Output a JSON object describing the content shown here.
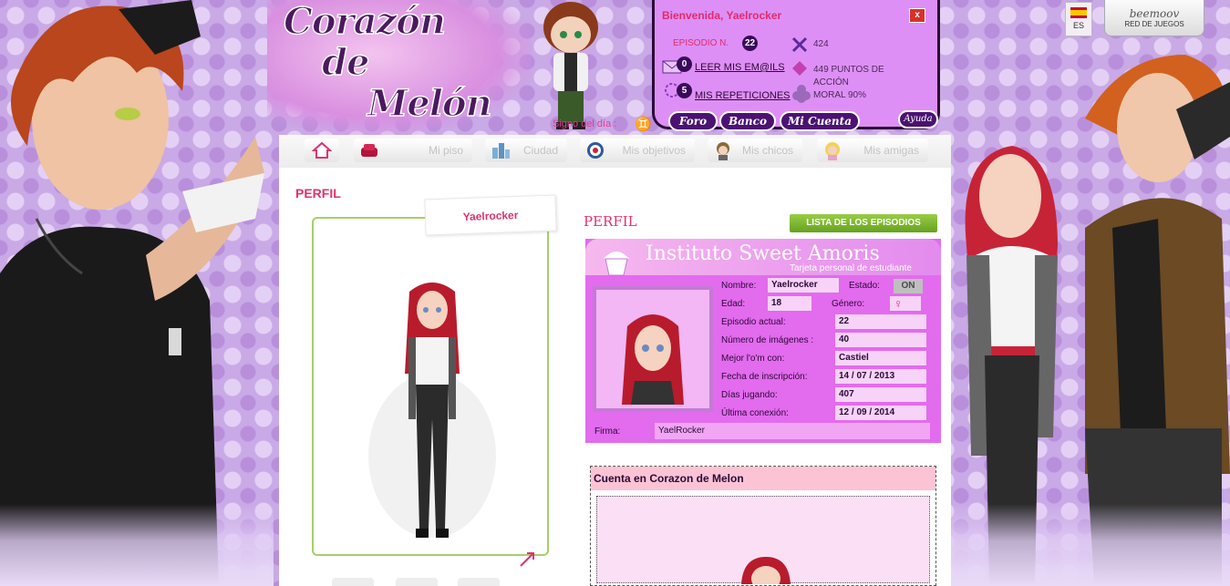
{
  "header": {
    "logo_line_1": "Corazón",
    "logo_line_2": "de",
    "logo_line_3": "Melón",
    "sign_label": "Signo del día :",
    "sign_icon": "gemini-icon"
  },
  "user_panel": {
    "welcome": "Bienvenida, Yaelrocker",
    "close_label": "x",
    "episode_label": "EPISODIO N.",
    "episode_number": "22",
    "stat_value": "424",
    "emails_count": "0",
    "emails_link": "LEER MIS EM@ILS",
    "action_points": "449 PUNTOS DE ACCIÓN",
    "reps_count": "5",
    "reps_link": "MIS REPETICIONES",
    "moral": "MORAL 90%",
    "buttons": [
      "Foro",
      "Banco",
      "Mi Cuenta"
    ],
    "help": "Ayuda"
  },
  "lang": {
    "label": "ES"
  },
  "beemoov": {
    "logo": "beemoov",
    "sub": "RED DE JUEGOS"
  },
  "nav": {
    "items": [
      {
        "label": "",
        "icon": "home-icon"
      },
      {
        "label": "Mi piso",
        "icon": "sofa-icon"
      },
      {
        "label": "Ciudad",
        "icon": "city-icon"
      },
      {
        "label": "Mis objetivos",
        "icon": "target-icon"
      },
      {
        "label": "Mis chicos",
        "icon": "boy-avatar-icon"
      },
      {
        "label": "Mis amigas",
        "icon": "girl-avatar-icon"
      }
    ]
  },
  "profile": {
    "title": "PERFIL",
    "username": "Yaelrocker",
    "perfil_title": "PERFIL",
    "episodes_button": "LISTA DE LOS EPISODIOS"
  },
  "card": {
    "title": "Instituto Sweet Amoris",
    "subtitle": "Tarjeta personal de estudiante",
    "nombre_label": "Nombre:",
    "nombre": "Yaelrocker",
    "estado_label": "Estado:",
    "estado": "ON",
    "edad_label": "Edad:",
    "edad": "18",
    "genero_label": "Género:",
    "genero_icon": "female-icon",
    "episodio_label": "Episodio actual:",
    "episodio": "22",
    "imagenes_label": "Número de imágenes :",
    "imagenes": "40",
    "mejor_label": "Mejor l'o'm con:",
    "mejor": "Castiel",
    "inscripcion_label": "Fecha de inscripción:",
    "inscripcion": "14 / 07 / 2013",
    "dias_label": "Días jugando:",
    "dias": "407",
    "conexion_label": "Última conexión:",
    "conexion": "12 / 09 / 2014",
    "firma_label": "Firma:",
    "firma": "YaelRocker"
  },
  "account": {
    "title": "Cuenta en Corazon de Melon"
  },
  "colors": {
    "accent": "#e0336b",
    "panel": "#de8ff5",
    "card": "#e36bee",
    "green_button": "#7ab534"
  }
}
